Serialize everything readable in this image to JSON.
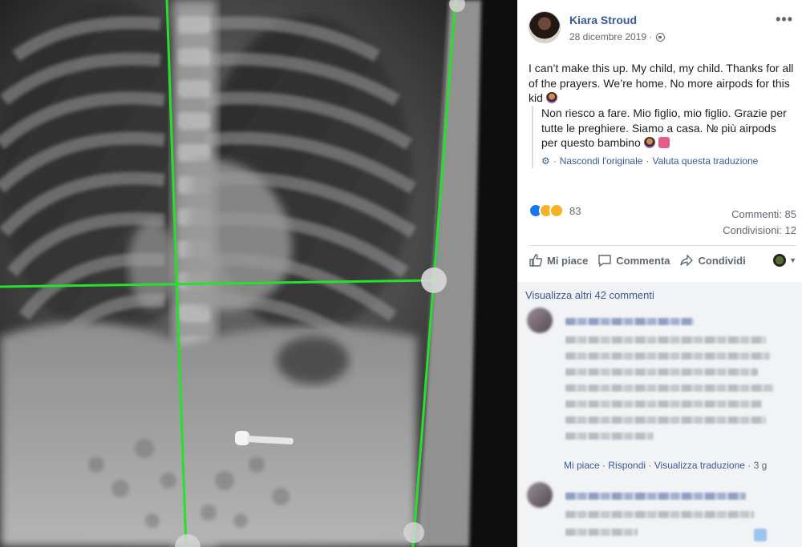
{
  "post": {
    "author": "Kiara Stroud",
    "date": "28 dicembre 2019 ·",
    "more_label": "•••",
    "text": "I can’t make this up. My child, my child. Thanks for all of the prayers. We’re home. No more airpods for this kid",
    "translation": "Non riesco a fare. Mio figlio, mio figlio. Grazie per tutte le preghiere. Siamo a casa. № più airpods per questo bambino",
    "hide_original": "Nascondi l'originale",
    "rate_translation": "Valuta questa traduzione",
    "separator": "·"
  },
  "stats": {
    "reaction_count": "83",
    "comments": "Commenti: 85",
    "shares": "Condivisioni: 12",
    "reaction_icons": [
      "like",
      "wow",
      "haha"
    ]
  },
  "actions": {
    "like": "Mi piace",
    "comment": "Commenta",
    "share": "Condividi"
  },
  "comments": {
    "view_more": "Visualizza altri 42 commenti",
    "footer_like": "Mi piace",
    "footer_reply": "Rispondi",
    "footer_translate": "Visualizza traduzione",
    "footer_time": "3 g"
  },
  "colors": {
    "link": "#385898",
    "guide_lines": "#22e32a",
    "panel_bg": "#ffffff",
    "comment_bg": "#f2f3f5"
  }
}
